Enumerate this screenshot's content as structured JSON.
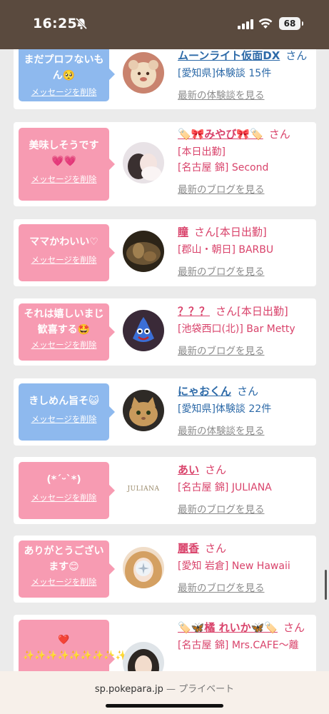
{
  "status": {
    "time": "16:25",
    "battery": "68"
  },
  "browser": {
    "url": "sp.pokepara.jp",
    "separator": "—",
    "mode": "プライベート"
  },
  "delete_label": "メッセージを削除",
  "colors": {
    "pink_bubble": "#f79bb2",
    "blue_bubble": "#8eb9ee",
    "pink_text": "#d9436b",
    "blue_text": "#2d6aa8"
  },
  "cards": [
    {
      "message": "まだプロフないもん🥺",
      "name": "ムーンライト仮面DX",
      "san": "さん",
      "lines": [
        "[愛知県]体験談 15件"
      ],
      "link": "最新の体験談を見る",
      "theme": "blue"
    },
    {
      "message": "美味しそうです💗💗",
      "name": "🏷️🎀みやび🎀🏷️",
      "san": "さん",
      "lines": [
        "[本日出勤]",
        "[名古屋 錦] Second"
      ],
      "link": "最新のブログを見る",
      "theme": "pink"
    },
    {
      "message": "ママかわいい♡",
      "name": "瞳",
      "san": "さん[本日出勤]",
      "lines": [
        "[郡山・朝日] BARBU"
      ],
      "link": "最新のブログを見る",
      "theme": "pink"
    },
    {
      "message": "それは嬉しいまじ歓喜する🤩",
      "name": "？？？",
      "san": "さん[本日出勤]",
      "lines": [
        "[池袋西口(北)] Bar Metty"
      ],
      "link": "最新のブログを見る",
      "theme": "pink"
    },
    {
      "message": "きしめん旨そ😺",
      "name": "にゃおくん",
      "san": "さん",
      "lines": [
        "[愛知県]体験談 22件"
      ],
      "link": "最新の体験談を見る",
      "theme": "blue"
    },
    {
      "message": "(*´ᵕ`*)",
      "name": "あい",
      "san": "さん",
      "lines": [
        "[名古屋 錦] JULIANA"
      ],
      "link": "最新のブログを見る",
      "theme": "pink",
      "avatar_text": "JULIANA"
    },
    {
      "message": "ありがとうございます😊",
      "name": "麗香",
      "san": "さん",
      "lines": [
        "[愛知 岩倉] New Hawaii"
      ],
      "link": "最新のブログを見る",
      "theme": "pink"
    },
    {
      "message": "❤️✨✨✨✨✨✨✨✨✨✨",
      "name": "🏷️🦋橘 れいか🦋🏷️",
      "san": "さん",
      "lines": [
        "[名古屋 錦] Mrs.CAFE〜離"
      ],
      "link": "",
      "theme": "pink"
    }
  ]
}
